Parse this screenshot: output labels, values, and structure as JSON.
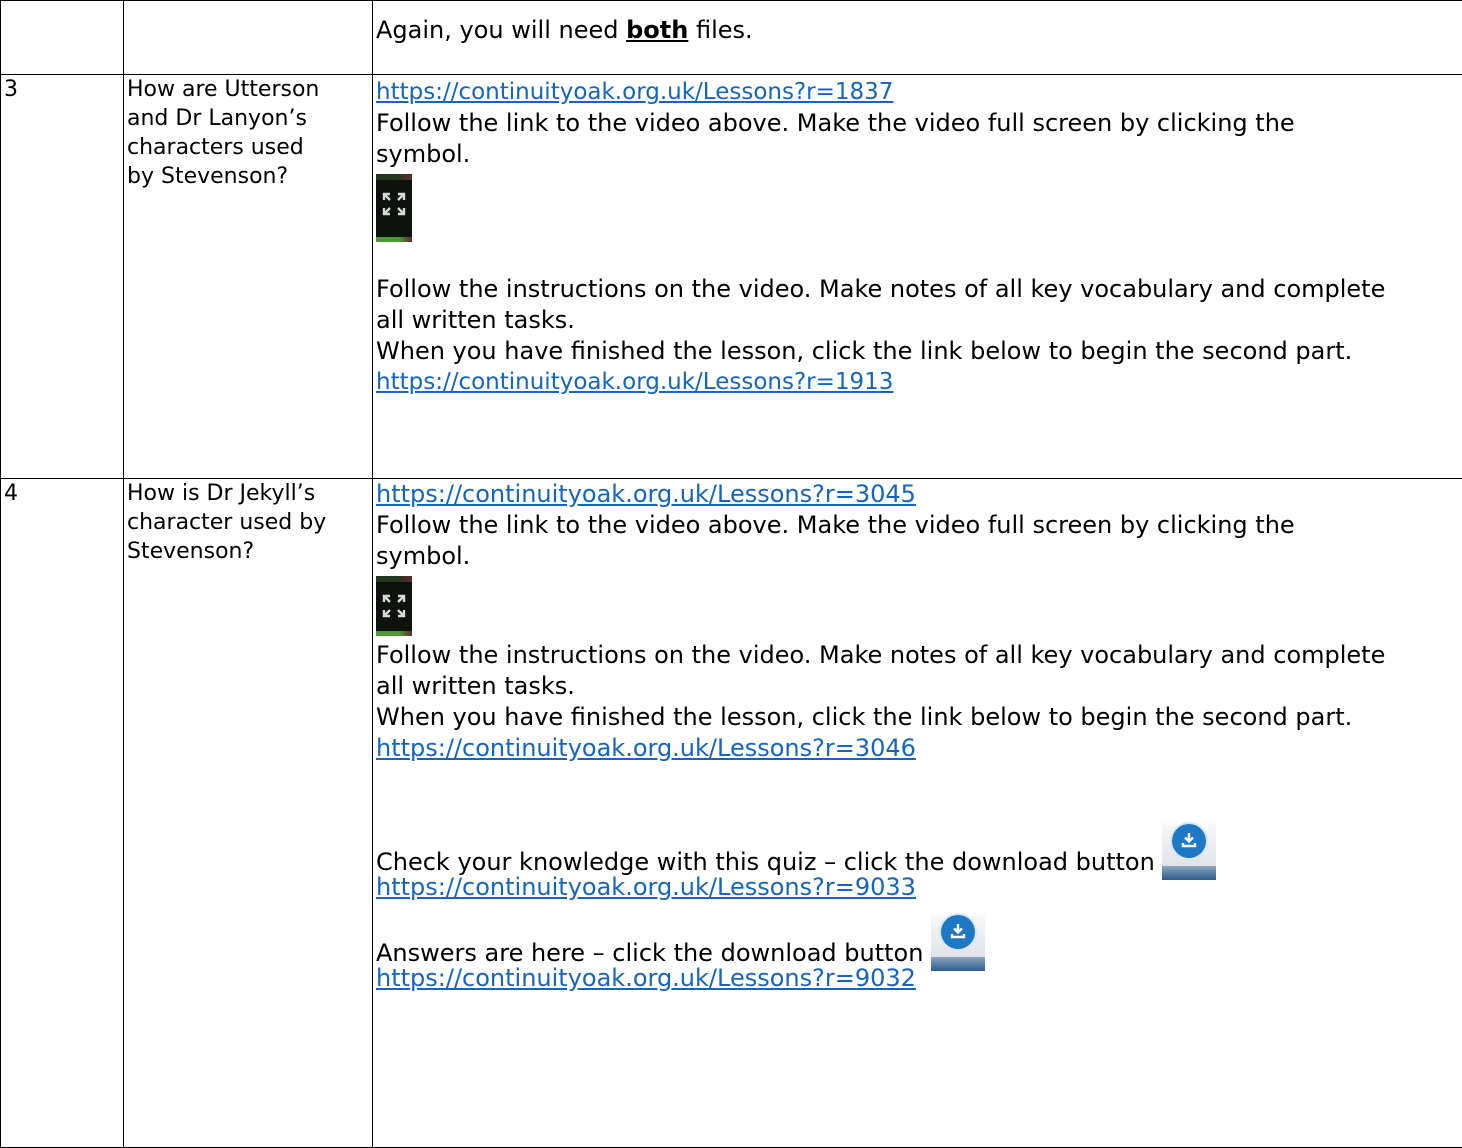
{
  "rows": [
    {
      "number": "",
      "question": "",
      "intro_prefix": "Again, you will need ",
      "intro_bold": "both",
      "intro_suffix": " files."
    },
    {
      "number": "3",
      "question_lines": [
        "How are Utterson",
        "and Dr Lanyon’s",
        "characters used",
        "by Stevenson?"
      ],
      "link1": "https://continuityoak.org.uk/Lessons?r=1837",
      "follow_line1": "Follow the link to the video above. Make the video full screen by clicking the",
      "follow_line2": "symbol.",
      "instr_line1": "Follow the instructions on the video. Make notes of all key vocabulary and complete",
      "instr_line2": "all written tasks.",
      "finish_line": "When you have finished the lesson, click the link below to begin the second part.",
      "link2": "https://continuityoak.org.uk/Lessons?r=1913"
    },
    {
      "number": "4",
      "question_lines": [
        "How is Dr Jekyll’s",
        "character used by",
        "Stevenson?"
      ],
      "link1": "https://continuityoak.org.uk/Lessons?r=3045",
      "follow_line1": "Follow the link to the video above. Make the video full screen by clicking the",
      "follow_line2": "symbol.",
      "instr_line1": "Follow the instructions on the video. Make notes of all key vocabulary and complete",
      "instr_line2": "all written tasks.",
      "finish_line": "When you have finished the lesson, click the link below to begin the second part.",
      "link2": "https://continuityoak.org.uk/Lessons?r=3046",
      "quiz_text": "Check your knowledge with this quiz – click the download button",
      "quiz_link": "https://continuityoak.org.uk/Lessons?r=9033",
      "answers_text": "Answers are here – click the download button",
      "answers_link": "https://continuityoak.org.uk/Lessons?r=9032"
    }
  ],
  "icons": {
    "fullscreen": "fullscreen-icon",
    "download": "download-icon"
  },
  "colors": {
    "link": "#1565c0",
    "border": "#000000"
  }
}
